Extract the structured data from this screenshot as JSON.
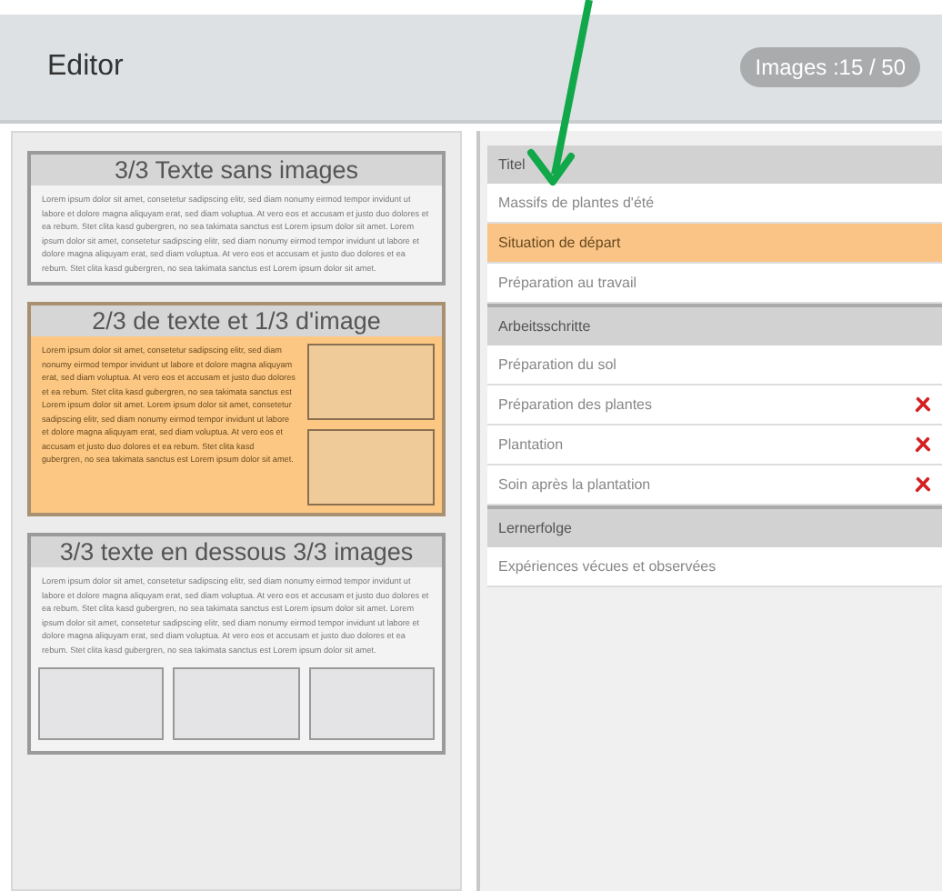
{
  "header": {
    "title": "Editor",
    "badge": "Images :15 / 50"
  },
  "layouts": [
    {
      "kind": "text",
      "title": "3/3 Texte sans images",
      "text": "Lorem ipsum dolor sit amet, consetetur sadipscing elitr, sed diam nonumy eirmod tempor invidunt ut labore et dolore magna aliquyam erat, sed diam voluptua. At vero eos et accusam et justo duo dolores et ea rebum. Stet clita kasd gubergren, no sea takimata sanctus est Lorem ipsum dolor sit amet. Lorem ipsum dolor sit amet, consetetur sadipscing elitr, sed diam nonumy eirmod tempor invidunt ut labore et dolore magna aliquyam erat, sed diam voluptua. At vero eos et accusam et justo duo dolores et ea rebum. Stet clita kasd gubergren, no sea takimata sanctus est Lorem ipsum dolor sit amet.",
      "selected": false
    },
    {
      "kind": "text-image",
      "title": "2/3 de texte et 1/3 d'image",
      "text": "Lorem ipsum dolor sit amet, consetetur sadipscing elitr, sed diam nonumy eirmod tempor invidunt ut labore et dolore magna aliquyam erat, sed diam voluptua. At vero eos et accusam et justo duo dolores et ea rebum. Stet clita kasd gubergren, no sea takimata sanctus est Lorem ipsum dolor sit amet. Lorem ipsum dolor sit amet, consetetur sadipscing elitr, sed diam nonumy eirmod tempor invidunt ut labore et dolore magna aliquyam erat, sed diam voluptua. At vero eos et accusam et justo duo dolores et ea rebum. Stet clita kasd gubergren, no sea takimata sanctus est Lorem ipsum dolor sit amet.",
      "selected": true
    },
    {
      "kind": "text-below-images",
      "title": "3/3 texte en dessous 3/3 images",
      "text": "Lorem ipsum dolor sit amet, consetetur sadipscing elitr, sed diam nonumy eirmod tempor invidunt ut labore et dolore magna aliquyam erat, sed diam voluptua. At vero eos et accusam et justo duo dolores et ea rebum. Stet clita kasd gubergren, no sea takimata sanctus est Lorem ipsum dolor sit amet. Lorem ipsum dolor sit amet, consetetur sadipscing elitr, sed diam nonumy eirmod tempor invidunt ut labore et dolore magna aliquyam erat, sed diam voluptua. At vero eos et accusam et justo duo dolores et ea rebum. Stet clita kasd gubergren, no sea takimata sanctus est Lorem ipsum dolor sit amet.",
      "selected": false
    }
  ],
  "sections": [
    {
      "title": "Titel",
      "items": [
        {
          "label": "Massifs de plantes d'été",
          "selected": false,
          "removable": false
        },
        {
          "label": "Situation de départ",
          "selected": true,
          "removable": false
        },
        {
          "label": "Préparation au travail",
          "selected": false,
          "removable": false
        }
      ]
    },
    {
      "title": "Arbeitsschritte",
      "items": [
        {
          "label": "Préparation du sol",
          "selected": false,
          "removable": false
        },
        {
          "label": "Préparation des plantes",
          "selected": false,
          "removable": true
        },
        {
          "label": "Plantation",
          "selected": false,
          "removable": true
        },
        {
          "label": "Soin après la plantation",
          "selected": false,
          "removable": true
        }
      ]
    },
    {
      "title": "Lernerfolge",
      "items": [
        {
          "label": "Expériences vécues et observées",
          "selected": false,
          "removable": false
        }
      ]
    }
  ]
}
